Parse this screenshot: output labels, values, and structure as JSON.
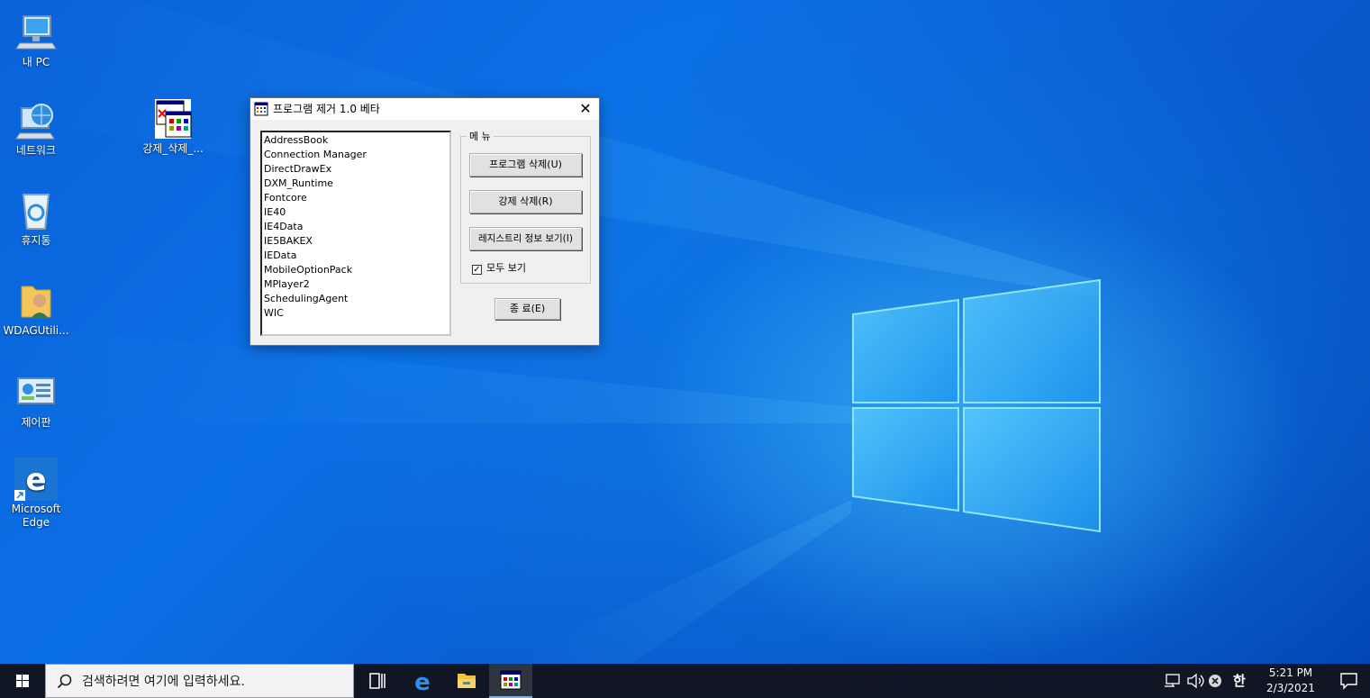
{
  "desktop": {
    "icons": [
      {
        "label": "내 PC",
        "icon": "this-pc-icon"
      },
      {
        "label": "네트워크",
        "icon": "network-icon"
      },
      {
        "label": "휴지통",
        "icon": "recycle-bin-icon"
      },
      {
        "label": "WDAGUtili...",
        "icon": "user-folder-icon"
      },
      {
        "label": "제어판",
        "icon": "control-panel-icon"
      },
      {
        "label": "Microsoft Edge",
        "icon": "edge-icon"
      },
      {
        "label": "강제_삭제_...",
        "icon": "program-shortcut-icon"
      }
    ]
  },
  "window": {
    "title": "프로그램 제거 1.0 베타",
    "close_label": "✕",
    "programs": [
      "AddressBook",
      "Connection Manager",
      "DirectDrawEx",
      "DXM_Runtime",
      "Fontcore",
      "IE40",
      "IE4Data",
      "IE5BAKEX",
      "IEData",
      "MobileOptionPack",
      "MPlayer2",
      "SchedulingAgent",
      "WIC"
    ],
    "menu_legend": "메 뉴",
    "buttons": {
      "uninstall": "프로그램 삭제(U)",
      "force": "강제 삭제(R)",
      "registry": "레지스트리 정보 보기(I)",
      "exit": "종 료(E)"
    },
    "show_all": {
      "label": "모두 보기",
      "checked": true,
      "mark": "✓"
    }
  },
  "taskbar": {
    "search_placeholder": "검색하려면 여기에 입력하세요.",
    "tray": {
      "ime": "한",
      "time": "5:21 PM",
      "date": "2/3/2021"
    }
  },
  "colors": {
    "wallpaper": "#0a5fd1",
    "taskbar": "#101624",
    "window_bg": "#f0f0f0"
  }
}
